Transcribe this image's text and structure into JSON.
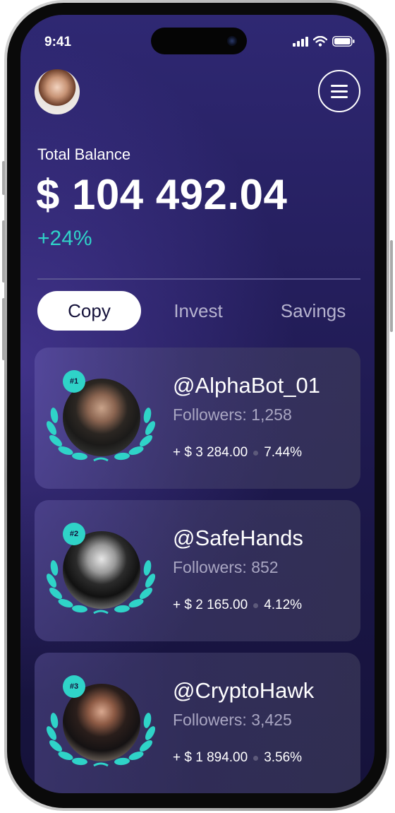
{
  "status_bar": {
    "time": "9:41"
  },
  "icons": {
    "avatar": "user-avatar",
    "menu": "hamburger-menu-icon",
    "signal": "signal-icon",
    "wifi": "wifi-icon",
    "battery": "battery-icon"
  },
  "balance": {
    "label": "Total Balance",
    "amount": "$ 104 492.04",
    "change": "+24%"
  },
  "tabs": [
    {
      "label": "Copy",
      "active": true
    },
    {
      "label": "Invest",
      "active": false
    },
    {
      "label": "Savings",
      "active": false
    }
  ],
  "traders": [
    {
      "rank": "#1",
      "handle": "@AlphaBot_01",
      "followers": "Followers: 1,258",
      "profit": "+ $ 3 284.00",
      "percent": "7.44%"
    },
    {
      "rank": "#2",
      "handle": "@SafeHands",
      "followers": "Followers: 852",
      "profit": "+ $ 2 165.00",
      "percent": "4.12%"
    },
    {
      "rank": "#3",
      "handle": "@CryptoHawk",
      "followers": "Followers: 3,425",
      "profit": "+ $ 1 894.00",
      "percent": "3.56%"
    }
  ],
  "colors": {
    "accent": "#2fd3c8",
    "background": "#241e5c",
    "tab_active_bg": "#ffffff"
  }
}
